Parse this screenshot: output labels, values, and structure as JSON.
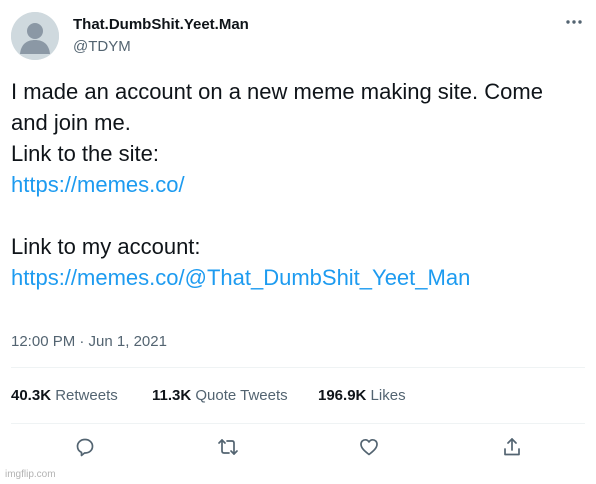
{
  "user": {
    "display_name": "That.DumbShit.Yeet.Man",
    "handle": "@TDYM",
    "avatar_icon": "default-avatar-icon"
  },
  "menu_icon": "more-horizontal-icon",
  "tweet": {
    "line1": "I made an account on a new meme making site. Come",
    "line2": "and join me.",
    "line3": "Link to the site:",
    "link1": "https://memes.co/",
    "line5": "Link to my account:",
    "link2": "https://memes.co/@That_DumbShit_Yeet_Man"
  },
  "timestamp": "12:00 PM · Jun 1, 2021",
  "stats": {
    "retweets_count": "40.3K",
    "retweets_label": "Retweets",
    "quotes_count": "11.3K",
    "quotes_label": "Quote Tweets",
    "likes_count": "196.9K",
    "likes_label": "Likes"
  },
  "actions": [
    "reply-icon",
    "retweet-icon",
    "like-icon",
    "share-icon"
  ],
  "watermark": "imgflip.com",
  "colors": {
    "text": "#0f1419",
    "secondary": "#536471",
    "link": "#1d9bf0",
    "divider": "#eff3f4",
    "avatar_bg": "#cfd9de"
  }
}
